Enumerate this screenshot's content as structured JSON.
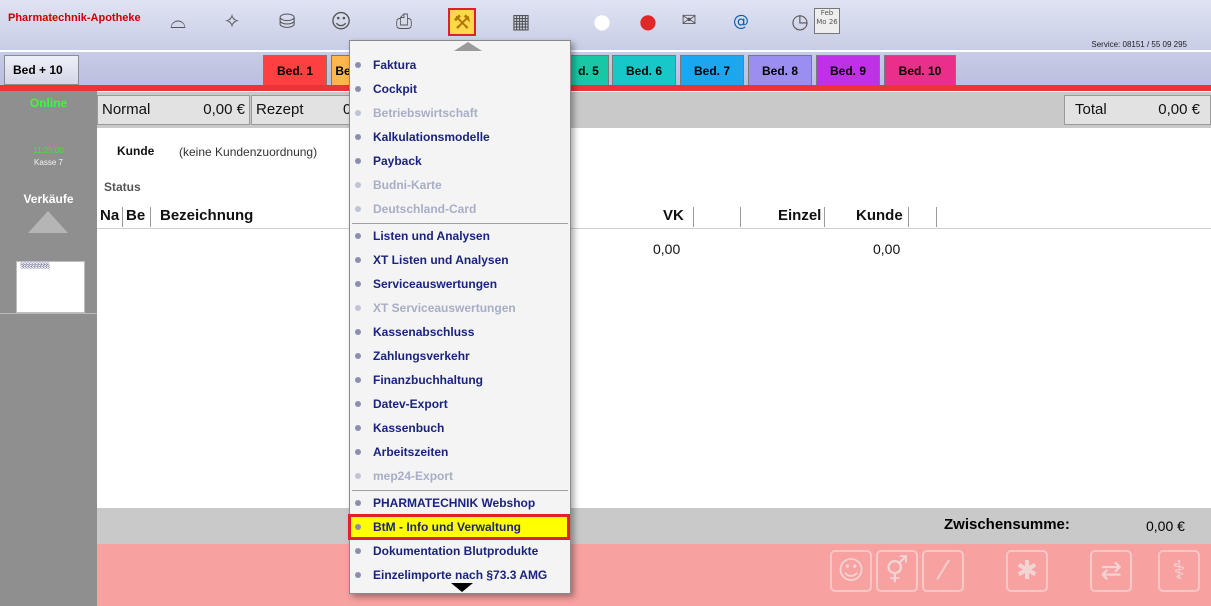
{
  "app": {
    "brand": "Pharmatechnik-Apotheke",
    "service": "Service: 08151 / 55 09 295",
    "calendar": "Feb\nMo 26"
  },
  "toolbar_icons": [
    "bowl-icon",
    "handshake-icon",
    "bag-icon",
    "people-icon",
    "printer-icon",
    "tools-menu-icon",
    "cash-register-icon",
    "payback-icon",
    "chat-icon",
    "mail-icon",
    "at-icon",
    "clock-icon",
    "calendar-icon"
  ],
  "tabs": {
    "bed_plus": "Bed + 10",
    "items": [
      {
        "label": "Bed. 1",
        "color": "#ff4040"
      },
      {
        "label": "Be",
        "color": "#ffb64d"
      },
      {
        "label": "d. 5",
        "color": "#18c7a3"
      },
      {
        "label": "Bed. 6",
        "color": "#18c7c7"
      },
      {
        "label": "Bed. 7",
        "color": "#1aa7f0"
      },
      {
        "label": "Bed. 8",
        "color": "#9a8ef0"
      },
      {
        "label": "Bed. 9",
        "color": "#c030e8"
      },
      {
        "label": "Bed. 10",
        "color": "#e83088"
      }
    ]
  },
  "left": {
    "online": "Online",
    "time": "11:25:00",
    "kasse": "Kasse 7",
    "verkaeufe": "Verkäufe"
  },
  "header": {
    "normal_label": "Normal",
    "normal_value": "0,00 €",
    "rezept_label": "Rezept",
    "rezept_value": "0",
    "total_label": "Total",
    "total_value": "0,00 €"
  },
  "customer": {
    "label": "Kunde",
    "value": "(keine Kundenzuordnung)",
    "status_label": "Status"
  },
  "table": {
    "columns": [
      "Na",
      "Be",
      "Bezeichnung",
      "VK",
      "Einzel",
      "Kunde"
    ],
    "vk_value": "0,00",
    "kunde_value": "0,00"
  },
  "footer": {
    "zwischensumme_label": "Zwischensumme:",
    "zwischensumme_value": "0,00 €"
  },
  "menu": {
    "groups": [
      [
        {
          "label": "Faktura",
          "enabled": true
        },
        {
          "label": "Cockpit",
          "enabled": true
        },
        {
          "label": "Betriebswirtschaft",
          "enabled": false
        },
        {
          "label": "Kalkulationsmodelle",
          "enabled": true
        },
        {
          "label": "Payback",
          "enabled": true
        },
        {
          "label": "Budni-Karte",
          "enabled": false
        },
        {
          "label": "Deutschland-Card",
          "enabled": false
        }
      ],
      [
        {
          "label": "Listen und Analysen",
          "enabled": true
        },
        {
          "label": "XT Listen und Analysen",
          "enabled": true
        },
        {
          "label": "Serviceauswertungen",
          "enabled": true
        },
        {
          "label": "XT Serviceauswertungen",
          "enabled": false
        },
        {
          "label": "Kassenabschluss",
          "enabled": true
        },
        {
          "label": "Zahlungsverkehr",
          "enabled": true
        },
        {
          "label": "Finanzbuchhaltung",
          "enabled": true
        },
        {
          "label": "Datev-Export",
          "enabled": true
        },
        {
          "label": "Kassenbuch",
          "enabled": true
        },
        {
          "label": "Arbeitszeiten",
          "enabled": true
        },
        {
          "label": "mep24-Export",
          "enabled": false
        }
      ],
      [
        {
          "label": "PHARMATECHNIK Webshop",
          "enabled": true
        },
        {
          "label": "BtM - Info und Verwaltung",
          "enabled": true,
          "highlighted": true
        },
        {
          "label": "Dokumentation Blutprodukte",
          "enabled": true
        },
        {
          "label": "Einzelimporte nach §73.3 AMG",
          "enabled": true
        }
      ]
    ]
  },
  "colors": {
    "highlight": "#ffff00",
    "highlight_border": "#e0202a",
    "menu_text": "#1a237e",
    "online": "#33ff33"
  }
}
